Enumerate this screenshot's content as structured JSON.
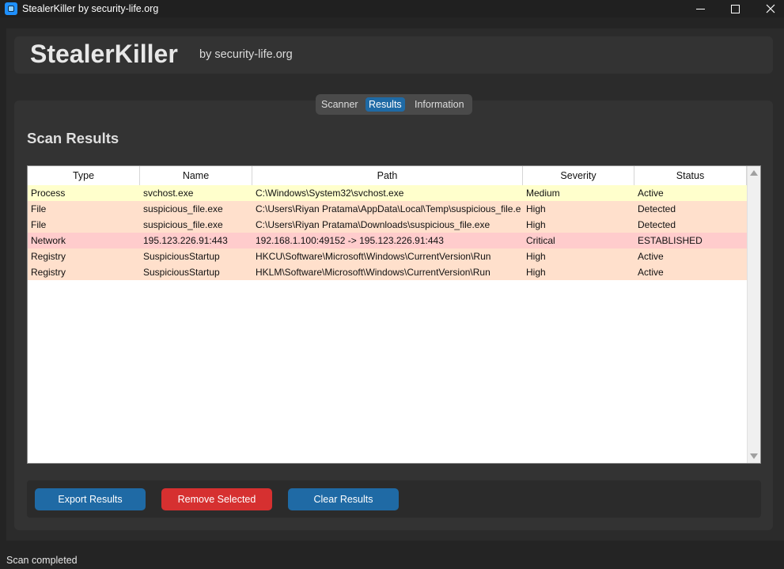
{
  "window": {
    "title": "StealerKiller by security-life.org"
  },
  "header": {
    "title": "StealerKiller",
    "subtitle": "by security-life.org"
  },
  "tabs": [
    {
      "label": "Scanner",
      "active": false
    },
    {
      "label": "Results",
      "active": true
    },
    {
      "label": "Information",
      "active": false
    }
  ],
  "results": {
    "heading": "Scan Results",
    "columns": [
      "Type",
      "Name",
      "Path",
      "Severity",
      "Status"
    ],
    "rows": [
      {
        "type": "Process",
        "name": "svchost.exe",
        "path": "C:\\Windows\\System32\\svchost.exe",
        "severity": "Medium",
        "status": "Active",
        "color": "#ffffcc"
      },
      {
        "type": "File",
        "name": "suspicious_file.exe",
        "path": "C:\\Users\\Riyan Pratama\\AppData\\Local\\Temp\\suspicious_file.e",
        "severity": "High",
        "status": "Detected",
        "color": "#ffe0cc"
      },
      {
        "type": "File",
        "name": "suspicious_file.exe",
        "path": "C:\\Users\\Riyan Pratama\\Downloads\\suspicious_file.exe",
        "severity": "High",
        "status": "Detected",
        "color": "#ffe0cc"
      },
      {
        "type": "Network",
        "name": "195.123.226.91:443",
        "path": "192.168.1.100:49152 -> 195.123.226.91:443",
        "severity": "Critical",
        "status": "ESTABLISHED",
        "color": "#ffcccc"
      },
      {
        "type": "Registry",
        "name": "SuspiciousStartup",
        "path": "HKCU\\Software\\Microsoft\\Windows\\CurrentVersion\\Run",
        "severity": "High",
        "status": "Active",
        "color": "#ffe0cc"
      },
      {
        "type": "Registry",
        "name": "SuspiciousStartup",
        "path": "HKLM\\Software\\Microsoft\\Windows\\CurrentVersion\\Run",
        "severity": "High",
        "status": "Active",
        "color": "#ffe0cc"
      }
    ]
  },
  "buttons": {
    "export": "Export Results",
    "remove": "Remove Selected",
    "clear": "Clear Results"
  },
  "colors": {
    "accent": "#1f6aa5",
    "danger": "#d63030"
  },
  "status": {
    "text": "Scan completed"
  }
}
